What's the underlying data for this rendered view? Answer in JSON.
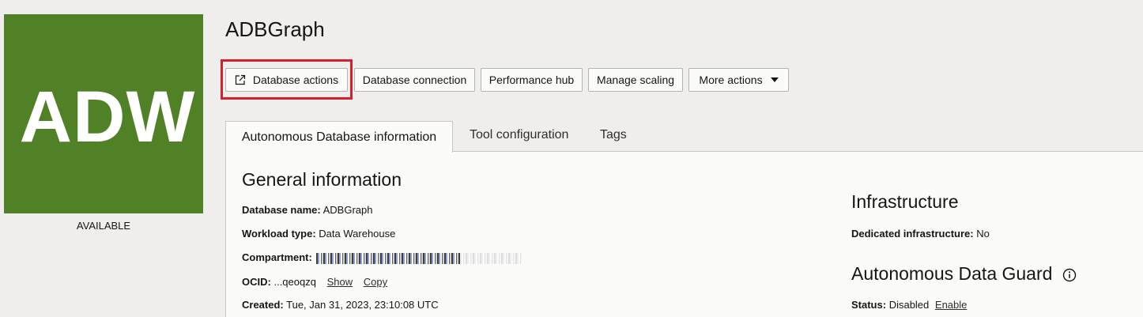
{
  "app": {
    "logo_text": "ADW",
    "lifecycle_state": "AVAILABLE",
    "title": "ADBGraph"
  },
  "actions": {
    "database_actions": "Database actions",
    "database_connection": "Database connection",
    "performance_hub": "Performance hub",
    "manage_scaling": "Manage scaling",
    "more_actions": "More actions"
  },
  "tabs": {
    "active": "Autonomous Database information",
    "tool_configuration": "Tool configuration",
    "tags": "Tags"
  },
  "general": {
    "heading": "General information",
    "database_name_label": "Database name:",
    "database_name_value": "ADBGraph",
    "workload_type_label": "Workload type:",
    "workload_type_value": "Data Warehouse",
    "compartment_label": "Compartment:",
    "ocid_label": "OCID:",
    "ocid_value": "...qeoqzq",
    "ocid_show": "Show",
    "ocid_copy": "Copy",
    "created_label": "Created:",
    "created_value": "Tue, Jan 31, 2023, 23:10:08 UTC"
  },
  "infrastructure": {
    "heading": "Infrastructure",
    "dedicated_label": "Dedicated infrastructure:",
    "dedicated_value": "No"
  },
  "data_guard": {
    "heading": "Autonomous Data Guard",
    "status_label": "Status:",
    "status_value": "Disabled",
    "enable_link": "Enable"
  },
  "colors": {
    "tile_bg": "#518126",
    "highlight": "#d71e2a"
  },
  "icons": {
    "external_link": "external-link-icon",
    "dropdown": "caret-down-icon",
    "info": "info-icon"
  }
}
